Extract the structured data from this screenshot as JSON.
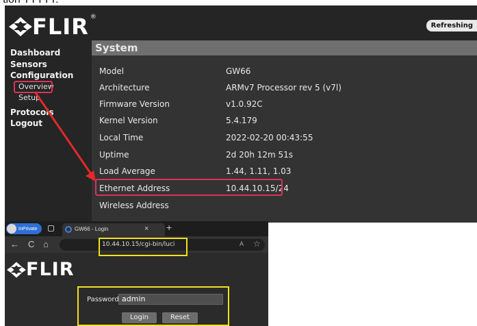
{
  "caption_fragment": "tion TTTTT.",
  "top": {
    "logo_text": "FLIR",
    "logo_reg": "®",
    "refresh_label": "Refreshing",
    "nav": {
      "dashboard": "Dashboard",
      "sensors": "Sensors",
      "configuration": "Configuration",
      "overview": "Overview",
      "setup": "Setup",
      "protocols": "Protocols",
      "logout": "Logout"
    },
    "section_title": "System",
    "rows": [
      {
        "label": "Model",
        "value": "GW66"
      },
      {
        "label": "Architecture",
        "value": "ARMv7 Processor rev 5 (v7l)"
      },
      {
        "label": "Firmware Version",
        "value": "v1.0.92C"
      },
      {
        "label": "Kernel Version",
        "value": "5.4.179"
      },
      {
        "label": "Local Time",
        "value": "2022-02-20 00:43:55"
      },
      {
        "label": "Uptime",
        "value": "2d 20h 12m 51s"
      },
      {
        "label": "Load Average",
        "value": "1.44, 1.11, 1.03"
      },
      {
        "label": "Ethernet Address",
        "value": "10.44.10.15/24"
      },
      {
        "label": "Wireless Address",
        "value": ""
      }
    ]
  },
  "bottom": {
    "inprivate_label": "InPrivate",
    "tab_title": "GW66 - Login",
    "tab_close": "×",
    "new_tab": "+",
    "nav": {
      "back": "←",
      "refresh": "C",
      "home": "⌂"
    },
    "address": "10.44.10.15/cgi-bin/luci",
    "read_aloud": "A",
    "favorite": "☆",
    "logo_text": "FLIR",
    "password_label": "Password",
    "password_value": "admin",
    "login_button": "Login",
    "reset_button": "Reset"
  },
  "colors": {
    "annotation_red": "#d9335b",
    "annotation_yellow": "#f2e21e",
    "panel_bg": "#252525",
    "header_gray": "#6f6f6f"
  }
}
